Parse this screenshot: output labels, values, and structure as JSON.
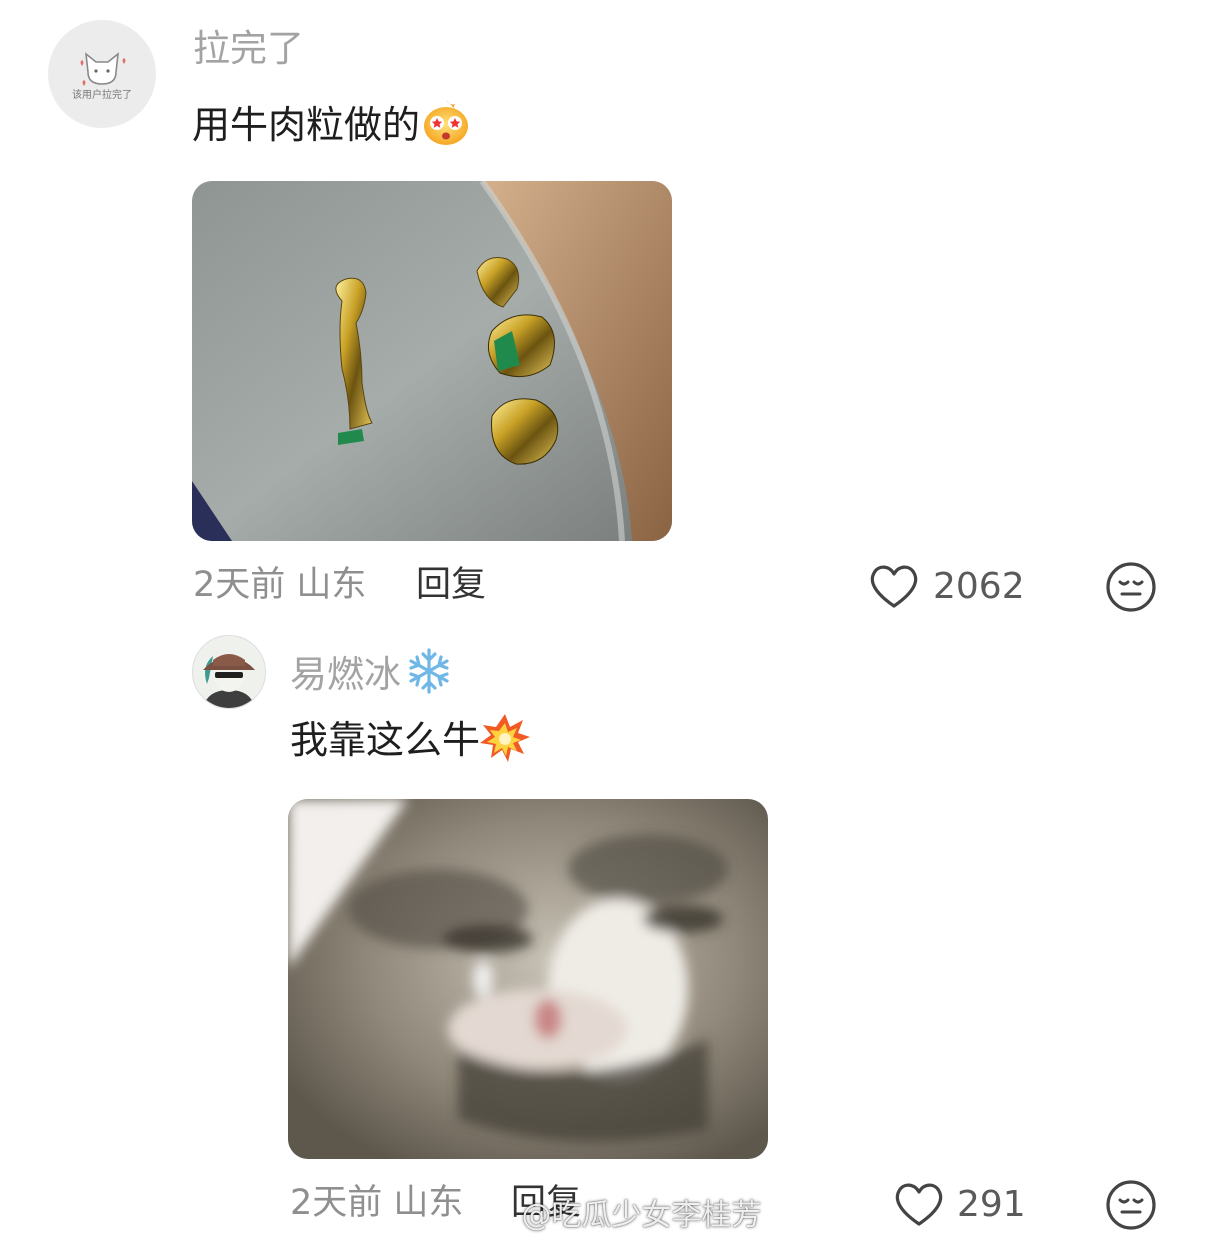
{
  "comment1": {
    "avatar_text": "该用户拉完了",
    "username": "拉完了",
    "text": "用牛肉粒做的",
    "emoji": "star-eyes-emoji",
    "photo": "candy-wrapper-photo",
    "time": "2天前",
    "location": "山东",
    "reply_label": "回复",
    "likes": "2062",
    "like_icon": "heart-icon",
    "dislike_icon": "meh-face-icon"
  },
  "comment2": {
    "username": "易燃冰",
    "username_emoji": "snowflake-emoji",
    "text": "我靠这么牛",
    "emoji": "collision-emoji",
    "photo": "cat-meme-photo",
    "time": "2天前",
    "location": "山东",
    "reply_label": "回复",
    "likes": "291",
    "like_icon": "heart-icon",
    "dislike_icon": "meh-face-icon"
  },
  "watermark": "@吃瓜少女李桂芳",
  "colors": {
    "username": "#a3a3a3",
    "text": "#1e1e1e",
    "meta": "#8f8f8f"
  }
}
